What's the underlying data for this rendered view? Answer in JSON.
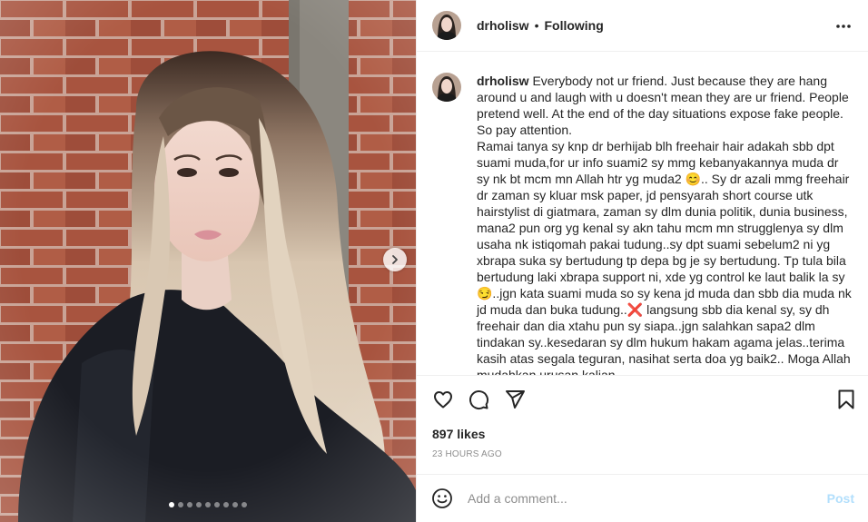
{
  "post": {
    "username": "drholisw",
    "separator": "•",
    "follow_status": "Following",
    "more_icon": "more-horizontal-icon",
    "carousel": {
      "total_slides": 9,
      "active_slide": 1
    }
  },
  "caption": {
    "username": "drholisw",
    "text": "Everybody not ur friend. Just because they are hang around u and laugh with u doesn't mean they are ur friend. People pretend well. At the end of the day situations expose fake people. So pay attention.\nRamai tanya sy knp dr berhijab blh freehair hair adakah sbb dpt suami muda,for ur info suami2 sy mmg kebanyakannya muda dr sy nk bt mcm mn Allah htr yg muda2 😊.. Sy dr azali mmg freehair dr zaman sy kluar msk paper, jd pensyarah short course utk hairstylist di giatmara, zaman sy dlm dunia politik, dunia business, mana2 pun org yg kenal sy akn tahu mcm mn strugglenya sy dlm usaha nk istiqomah pakai tudung..sy dpt suami sebelum2 ni yg xbrapa suka sy bertudung tp depa bg je sy bertudung. Tp tula bila bertudung laki xbrapa support ni, xde yg control ke laut balik la sy😏..jgn kata suami muda so sy kena jd muda dan sbb dia muda nk jd muda dan buka tudung..❌ langsung sbb dia kenal sy, sy dh freehair dan dia xtahu pun sy siapa..jgn salahkan sapa2 dlm tindakan sy..kesedaran sy dlm hukum hakam agama jelas..terima kasih atas segala teguran, nasihat serta doa yg baik2.. Moga Allah mudahkan urusan kalian"
  },
  "actions": {
    "like_icon": "heart-icon",
    "comment_icon": "comment-icon",
    "share_icon": "share-icon",
    "save_icon": "bookmark-icon"
  },
  "likes_text": "897 likes",
  "timestamp": "23 HOURS AGO",
  "comment_box": {
    "emoji_icon": "emoji-icon",
    "placeholder": "Add a comment...",
    "post_label": "Post"
  },
  "colors": {
    "link_disabled": "#b2dffc",
    "muted": "#8e8e8e",
    "text": "#262626",
    "divider": "#efefef"
  }
}
